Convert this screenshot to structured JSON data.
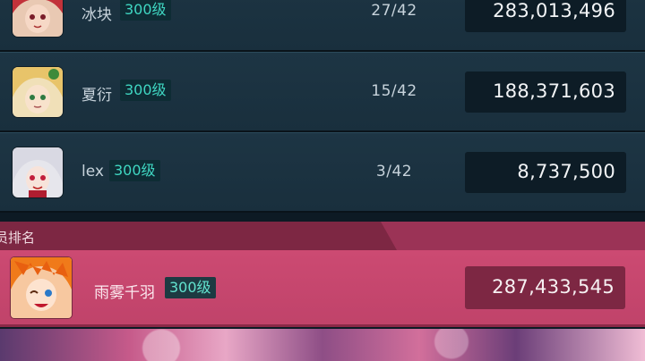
{
  "rows": [
    {
      "name": "冰块",
      "level": "300级",
      "progress": "27/42",
      "score": "283,013,496",
      "avatar": "red-hair-girl-avatar"
    },
    {
      "name": "夏衍",
      "level": "300级",
      "progress": "15/42",
      "score": "188,371,603",
      "avatar": "blonde-girl-avatar"
    },
    {
      "name": "lex",
      "level": "300级",
      "progress": "3/42",
      "score": "8,737,500",
      "avatar": "white-hair-girl-avatar"
    }
  ],
  "mine": {
    "section_title": "员排名",
    "name": "雨雾千羽",
    "level": "300级",
    "score": "287,433,545",
    "avatar": "orange-hair-winking-avatar"
  },
  "colors": {
    "row_bg": "#1b3241",
    "level_text": "#3fd7c2",
    "mine_bg": "#c8466e",
    "mine_header": "#7d2743"
  }
}
